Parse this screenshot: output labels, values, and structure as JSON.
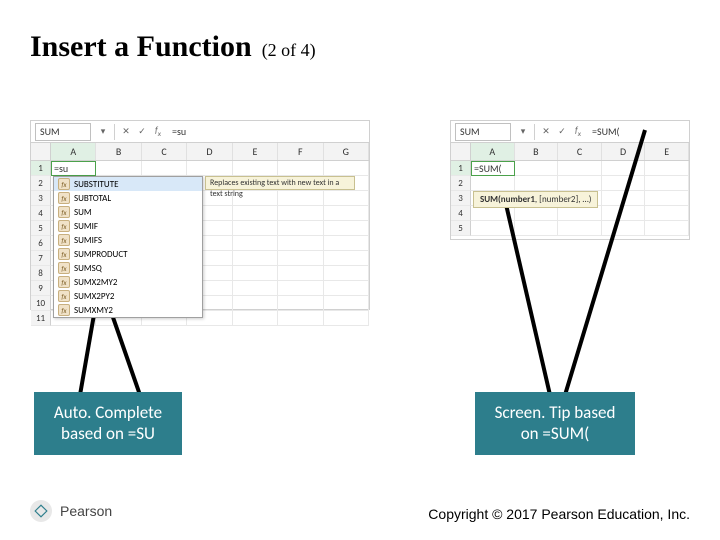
{
  "title": {
    "main": "Insert a Function",
    "sub": "(2 of 4)"
  },
  "left_shot": {
    "namebox": "SUM",
    "formula": "=su",
    "cellA1": "=su",
    "columns": [
      "A",
      "B",
      "C",
      "D",
      "E",
      "F",
      "G"
    ],
    "rows": [
      "1",
      "2",
      "3",
      "4",
      "5",
      "6",
      "7",
      "8",
      "9",
      "10",
      "11"
    ],
    "ac_items": [
      "SUBSTITUTE",
      "SUBTOTAL",
      "SUM",
      "SUMIF",
      "SUMIFS",
      "SUMPRODUCT",
      "SUMSQ",
      "SUMX2MY2",
      "SUMX2PY2",
      "SUMXMY2"
    ],
    "ac_desc": "Replaces existing text with new text in a text string"
  },
  "right_shot": {
    "namebox": "SUM",
    "formula": "=SUM(",
    "cellA1": "=SUM(",
    "columns": [
      "A",
      "B",
      "C",
      "D",
      "E"
    ],
    "rows": [
      "1",
      "2",
      "3",
      "4",
      "5"
    ],
    "tip_bold": "SUM(number1",
    "tip_rest": ", [number2], …)"
  },
  "callouts": {
    "left_l1": "Auto. Complete",
    "left_l2": "based on =SU",
    "right_l1": "Screen. Tip based",
    "right_l2": "on =SUM("
  },
  "footer": {
    "brand": "Pearson",
    "copyright": "Copyright © 2017 Pearson Education, Inc."
  }
}
